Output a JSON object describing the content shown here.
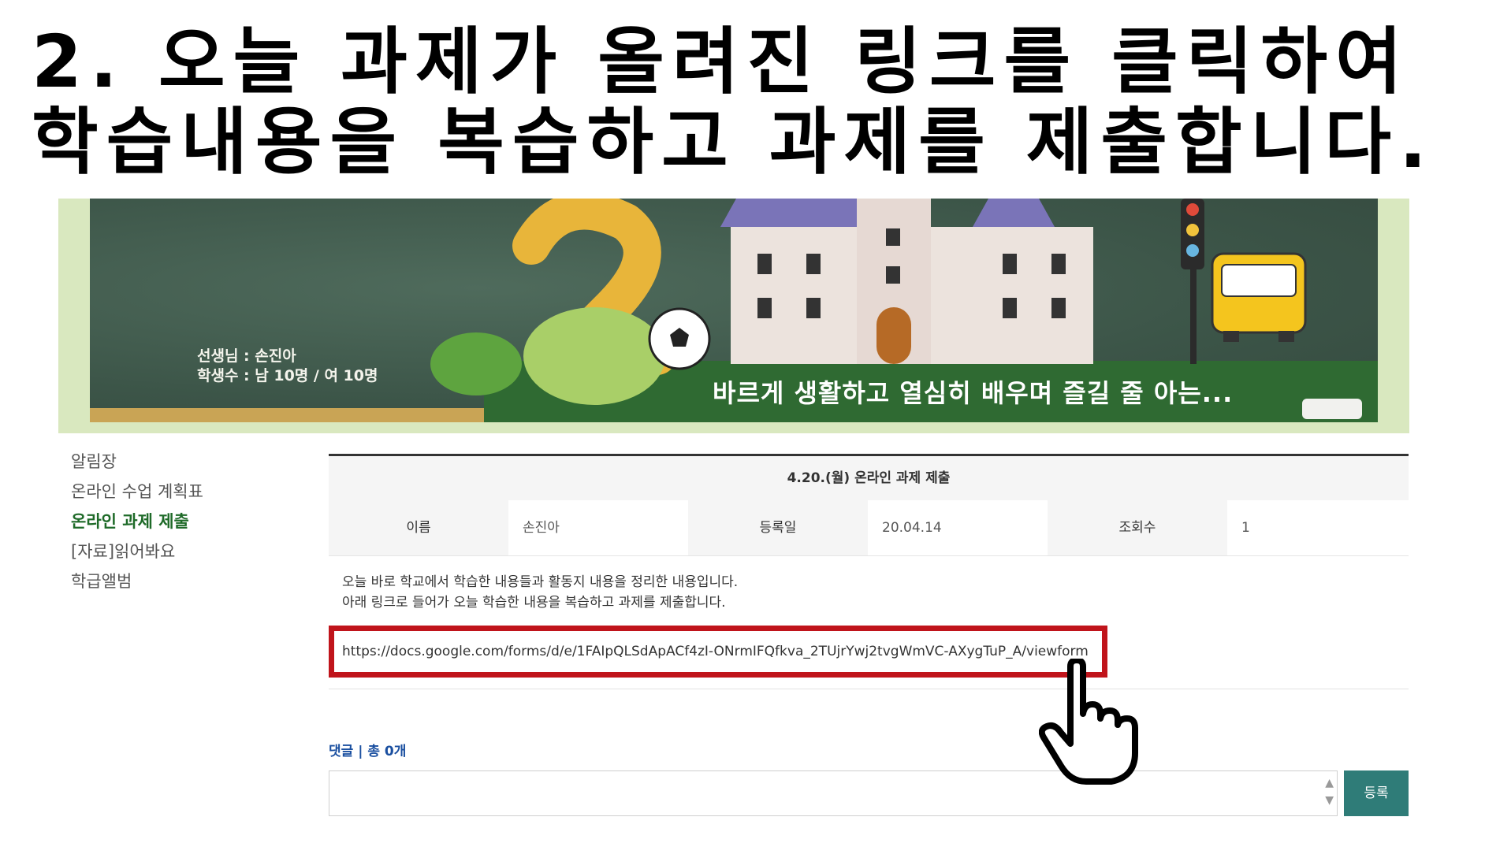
{
  "headline": {
    "line1": "2. 오늘 과제가 올려진 링크를 클릭하여",
    "line2": "학습내용을 복습하고 과제를 제출합니다."
  },
  "banner": {
    "teacher_line": "선생님 : 손진아",
    "students_line": "학생수 : 남 10명 / 여 10명",
    "motto": "바르게 생활하고 열심히 배우며 즐길 줄 아는..."
  },
  "sidebar": {
    "items": [
      {
        "label": "알림장",
        "active": false
      },
      {
        "label": "온라인 수업 계획표",
        "active": false
      },
      {
        "label": "온라인 과제 제출",
        "active": true
      },
      {
        "label": "[자료]읽어봐요",
        "active": false
      },
      {
        "label": "학급앨범",
        "active": false
      }
    ]
  },
  "post": {
    "title": "4.20.(월) 온라인 과제 제출",
    "meta": {
      "name_label": "이름",
      "name_value": "손진아",
      "date_label": "등록일",
      "date_value": "20.04.14",
      "views_label": "조회수",
      "views_value": "1"
    },
    "body_line1": "오늘 바로 학교에서 학습한 내용들과 활동지 내용을 정리한 내용입니다.",
    "body_line2": "아래 링크로 들어가 오늘 학습한 내용을 복습하고 과제를 제출합니다.",
    "link": "https://docs.google.com/forms/d/e/1FAIpQLSdApACf4zI-ONrmIFQfkva_2TUjrYwj2tvgWmVC-AXygTuP_A/viewform"
  },
  "comments": {
    "count_label": "댓글 | 총 0개",
    "submit_label": "등록"
  },
  "colors": {
    "highlight_box": "#c0141b",
    "active_nav": "#1e6a28",
    "submit_button": "#2f7c78",
    "comment_count": "#1a4fa0"
  },
  "icons": [
    "pointing-hand-icon",
    "scroll-up-arrow-icon",
    "scroll-down-arrow-icon"
  ]
}
